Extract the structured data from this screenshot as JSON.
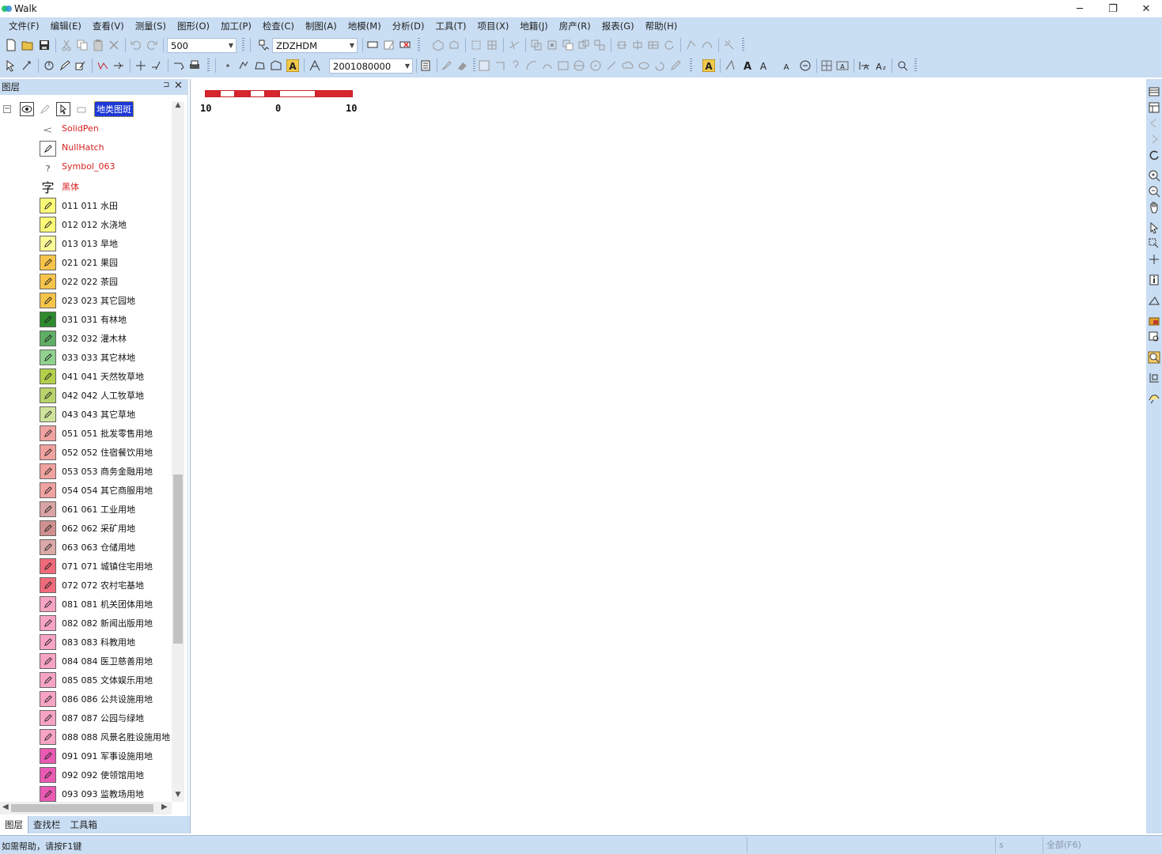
{
  "window": {
    "title": "Walk",
    "controls": {
      "minimize": "─",
      "maximize": "❐",
      "close": "✕"
    }
  },
  "menu": [
    "文件(F)",
    "编辑(E)",
    "查看(V)",
    "测量(S)",
    "图形(O)",
    "加工(P)",
    "检查(C)",
    "制图(A)",
    "地模(M)",
    "分析(D)",
    "工具(T)",
    "项目(X)",
    "地籍(J)",
    "房产(R)",
    "报表(G)",
    "帮助(H)"
  ],
  "toolbar1": {
    "scale_value": "500",
    "layer_code": "ZDZHDM"
  },
  "toolbar2": {
    "code_value": "2001080000"
  },
  "layer_panel": {
    "title": "图层",
    "pin": "⊐",
    "close": "✕",
    "root_label": "地类图斑",
    "style_rows": [
      {
        "label": "SolidPen",
        "icon": "pen-icon"
      },
      {
        "label": "NullHatch",
        "icon": "hatch-icon"
      },
      {
        "label": "Symbol_063",
        "icon": "question-icon"
      },
      {
        "label": "黑体",
        "icon": "font-icon",
        "glyph": "字"
      }
    ],
    "layers": [
      {
        "label": "011 011 水田",
        "color": "#fbfb78"
      },
      {
        "label": "012 012 水浇地",
        "color": "#fbfb78"
      },
      {
        "label": "013 013 旱地",
        "color": "#fbfb96"
      },
      {
        "label": "021 021 果园",
        "color": "#f6c44a"
      },
      {
        "label": "022 022 茶园",
        "color": "#f6c44a"
      },
      {
        "label": "023 023 其它园地",
        "color": "#f6c44a"
      },
      {
        "label": "031 031 有林地",
        "color": "#2d8a2d"
      },
      {
        "label": "032 032 灌木林",
        "color": "#5fae63"
      },
      {
        "label": "033 033 其它林地",
        "color": "#8fd18f"
      },
      {
        "label": "041 041 天然牧草地",
        "color": "#b3cf4b"
      },
      {
        "label": "042 042 人工牧草地",
        "color": "#b8d36a"
      },
      {
        "label": "043 043 其它草地",
        "color": "#cfe49a"
      },
      {
        "label": "051 051 批发零售用地",
        "color": "#f0a2a0"
      },
      {
        "label": "052 052 住宿餐饮用地",
        "color": "#f0a2a0"
      },
      {
        "label": "053 053 商务金融用地",
        "color": "#f0a2a0"
      },
      {
        "label": "054 054 其它商服用地",
        "color": "#f0a2a0"
      },
      {
        "label": "061 061 工业用地",
        "color": "#d9a3a3"
      },
      {
        "label": "062 062 采矿用地",
        "color": "#d0908e"
      },
      {
        "label": "063 063 仓储用地",
        "color": "#dba8a8"
      },
      {
        "label": "071 071 城镇住宅用地",
        "color": "#ef6a7a"
      },
      {
        "label": "072 072 农村宅基地",
        "color": "#ef6a7a"
      },
      {
        "label": "081 081 机关团体用地",
        "color": "#f7a3c3"
      },
      {
        "label": "082 082 新闻出版用地",
        "color": "#f7a3c3"
      },
      {
        "label": "083 083 科教用地",
        "color": "#f7a3c3"
      },
      {
        "label": "084 084 医卫慈善用地",
        "color": "#f7a3c3"
      },
      {
        "label": "085 085 文体娱乐用地",
        "color": "#f7a3c3"
      },
      {
        "label": "086 086 公共设施用地",
        "color": "#f7a3c3"
      },
      {
        "label": "087 087 公园与绿地",
        "color": "#f7a3c3"
      },
      {
        "label": "088 088 风景名胜设施用地",
        "color": "#f7a3c3"
      },
      {
        "label": "091 091 军事设施用地",
        "color": "#ea5ab3"
      },
      {
        "label": "092 092 使领馆用地",
        "color": "#ea5ab3"
      },
      {
        "label": "093 093 监教场用地",
        "color": "#ea5ab3"
      }
    ]
  },
  "bottom_tabs": [
    "图层",
    "查找栏",
    "工具箱"
  ],
  "scale_bar": {
    "left": "10",
    "mid": "0",
    "right": "10"
  },
  "status": {
    "help": "如需帮助，请按F1键",
    "pane2": "s",
    "pane3": "全部(F6)"
  },
  "colors": {
    "accent": "#c9ddf3",
    "selection": "#1c37d8",
    "scale_red": "#c8202a"
  }
}
